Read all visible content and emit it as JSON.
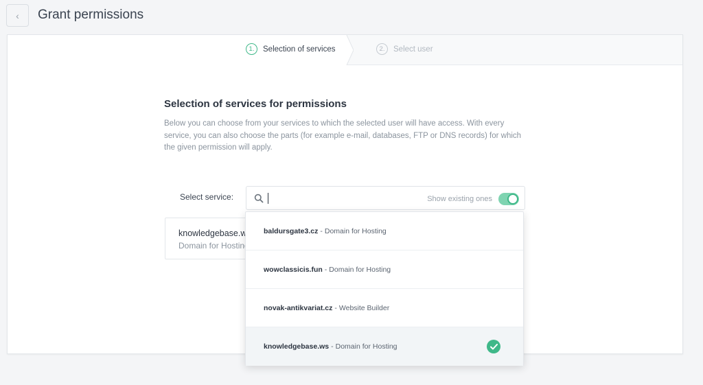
{
  "header": {
    "back_icon": "chevron-left-icon",
    "title": "Grant permissions"
  },
  "stepper": {
    "steps": [
      {
        "num": "1.",
        "label": "Selection of services",
        "state": "active"
      },
      {
        "num": "2.",
        "label": "Select user",
        "state": "inactive"
      }
    ],
    "accent": "#3fb889"
  },
  "section": {
    "heading": "Selection of services for permissions",
    "description": "Below you can choose from your services to which the selected user will have access. With every service, you can also choose the parts (for example e-mail, databases, FTP or DNS records) for which the given permission will apply."
  },
  "service_select": {
    "label": "Select service:",
    "search_icon": "search-icon",
    "search_value": "",
    "show_existing_label": "Show existing ones",
    "show_existing_on": true
  },
  "selected_service": {
    "name": "knowledgebase.ws",
    "type": "Domain for Hosting"
  },
  "dropdown": {
    "separator": "-",
    "items": [
      {
        "name": "baldursgate3.cz",
        "type": "Domain for Hosting",
        "selected": false
      },
      {
        "name": "wowclassicis.fun",
        "type": "Domain for Hosting",
        "selected": false
      },
      {
        "name": "novak-antikvariat.cz",
        "type": "Website Builder",
        "selected": false
      },
      {
        "name": "knowledgebase.ws",
        "type": "Domain for Hosting",
        "selected": true
      }
    ],
    "check_icon": "check-circle-icon"
  }
}
